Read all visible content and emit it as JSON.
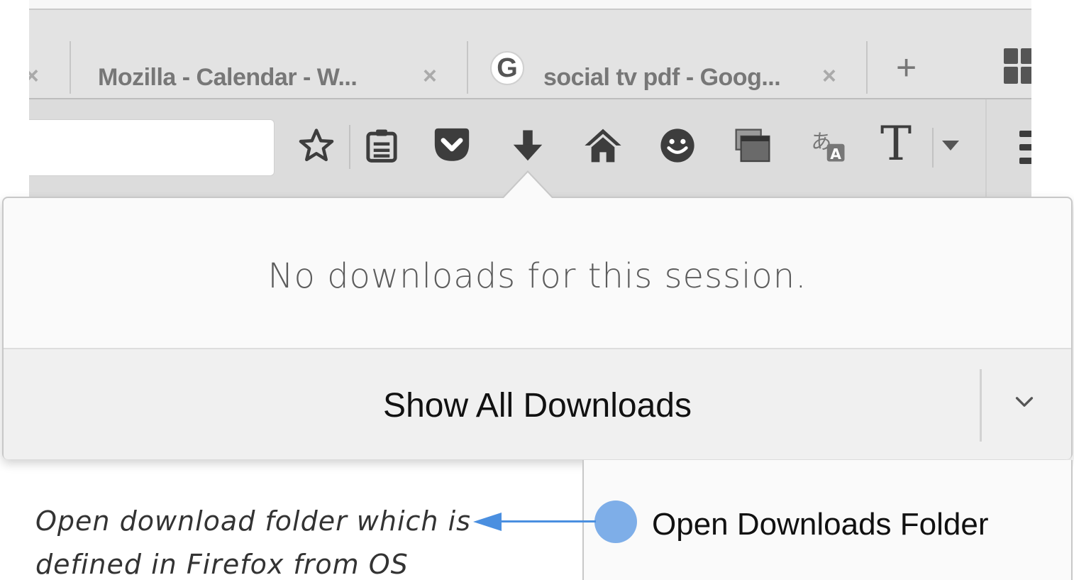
{
  "tabs": [
    {
      "title": "",
      "close": "×"
    },
    {
      "title": "Mozilla - Calendar - W...",
      "close": "×"
    },
    {
      "title": "social tv pdf - Goog...",
      "close": "×",
      "favicon": "G"
    }
  ],
  "new_tab": "+",
  "toolbar_icons": [
    "star-icon",
    "reading-list-icon",
    "pocket-icon",
    "download-icon",
    "home-icon",
    "smiley-icon",
    "window-icon",
    "translate-icon",
    "text-icon",
    "dropdown-icon",
    "menu-icon"
  ],
  "toolbar_text_icon": "T",
  "downloads_panel": {
    "empty_message": "No downloads for this session.",
    "show_all_label": "Show All Downloads"
  },
  "context_menu": {
    "open_folder_label": "Open Downloads Folder"
  },
  "annotation": {
    "text": "Open download folder which is defined in Firefox from OS"
  },
  "colors": {
    "hotspot": "#7eaee8",
    "arrow": "#4a8fe0"
  }
}
